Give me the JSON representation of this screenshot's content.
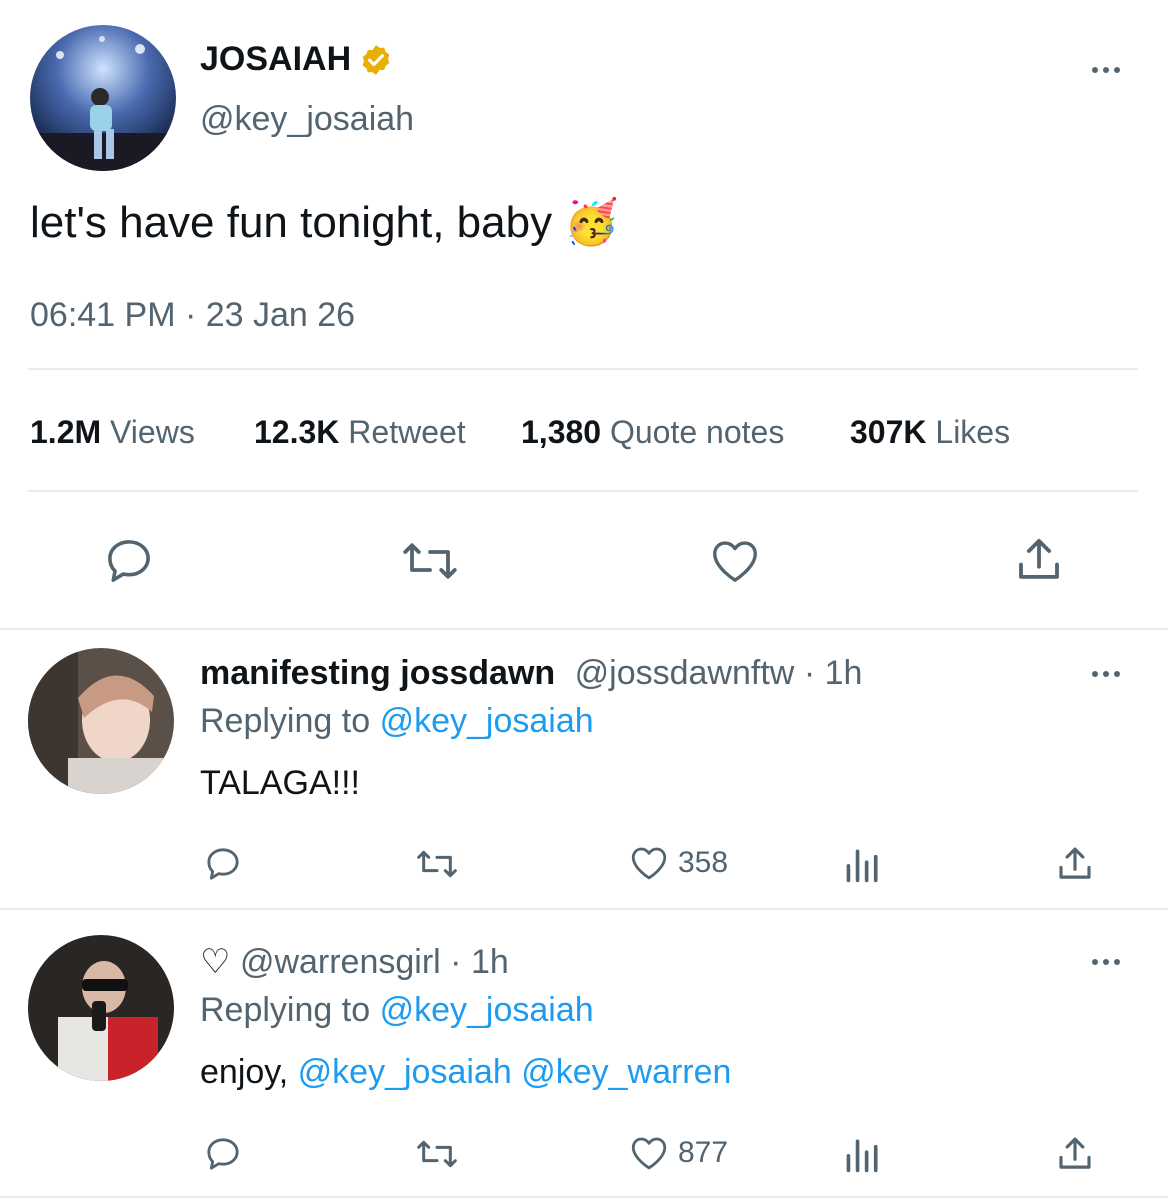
{
  "tweet": {
    "display_name": "JOSAIAH",
    "handle": "@key_josaiah",
    "text": "let's have fun tonight, baby",
    "emoji": "🥳",
    "timestamp": "06:41 PM · 23 Jan 26",
    "stats": [
      {
        "value": "1.2M",
        "label": "Views"
      },
      {
        "value": "12.3K",
        "label": "Retweet"
      },
      {
        "value": "1,380",
        "label": "Quote notes"
      },
      {
        "value": "307K",
        "label": "Likes"
      }
    ],
    "icons": [
      "reply-icon",
      "retweet-icon",
      "like-icon",
      "share-icon",
      "verified-badge-icon",
      "more-icon"
    ]
  },
  "replies": [
    {
      "display_name": "manifesting jossdawn",
      "handle": "@jossdawnftw",
      "time": "· 1h",
      "replying_label": "Replying to",
      "replying_handle": "@key_josaiah",
      "text": "TALAGA!!!",
      "like_count": "358"
    },
    {
      "display_name": "♡",
      "handle": "@warrensgirl",
      "time": "· 1h",
      "replying_label": "Replying to",
      "replying_handle": "@key_josaiah",
      "text_prefix": "enjoy, ",
      "mention_1": "@key_josaiah",
      "mention_2": "@key_warren",
      "like_count": "877"
    }
  ],
  "colors": {
    "accent": "#1d9bf0",
    "text": "#0f1419",
    "secondary": "#536471",
    "verified": "#e8b004",
    "divider": "#e6ecf0"
  }
}
